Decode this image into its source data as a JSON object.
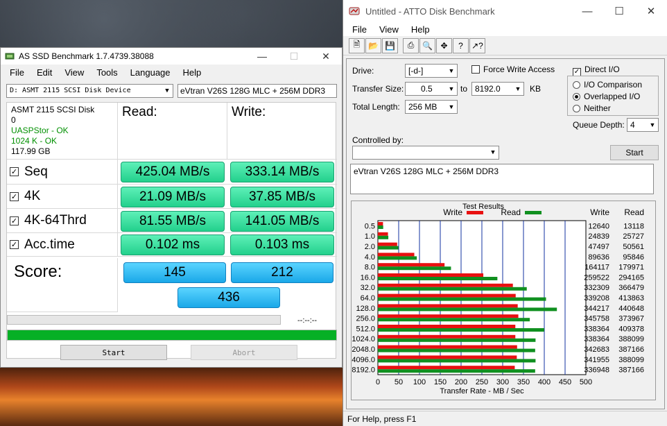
{
  "asssd": {
    "title": "AS SSD Benchmark 1.7.4739.38088",
    "menu": [
      "File",
      "Edit",
      "View",
      "Tools",
      "Language",
      "Help"
    ],
    "device_select": "D: ASMT 2115 SCSI Disk Device",
    "device_name": "eVtran V26S 128G MLC + 256M DDR3",
    "info": {
      "model": "ASMT 2115 SCSI Disk",
      "num": "0",
      "driver": "UASPStor - OK",
      "align": "1024 K - OK",
      "size": "117.99 GB"
    },
    "read_header": "Read:",
    "write_header": "Write:",
    "rows": [
      {
        "label": "Seq",
        "read": "425.04 MB/s",
        "write": "333.14 MB/s"
      },
      {
        "label": "4K",
        "read": "21.09 MB/s",
        "write": "37.85 MB/s"
      },
      {
        "label": "4K-64Thrd",
        "read": "81.55 MB/s",
        "write": "141.05 MB/s"
      },
      {
        "label": "Acc.time",
        "read": "0.102 ms",
        "write": "0.103 ms"
      }
    ],
    "score_label": "Score:",
    "score_read": "145",
    "score_write": "212",
    "score_total": "436",
    "timer": "--:--:--",
    "progress_fraction": 1.0,
    "start_label": "Start",
    "abort_label": "Abort"
  },
  "atto": {
    "title": "Untitled - ATTO Disk Benchmark",
    "menu": [
      "File",
      "View",
      "Help"
    ],
    "drive_label": "Drive:",
    "drive_value": "[-d-]",
    "force_write": "Force Write Access",
    "direct_io": "Direct I/O",
    "transfer_size_label": "Transfer Size:",
    "ts_from": "0.5",
    "ts_to_label": "to",
    "ts_to": "8192.0",
    "ts_unit": "KB",
    "io_comparison": "I/O Comparison",
    "overlapped_io": "Overlapped I/O",
    "neither": "Neither",
    "total_length_label": "Total Length:",
    "total_length": "256 MB",
    "queue_depth_label": "Queue Depth:",
    "queue_depth": "4",
    "controlled_by": "Controlled by:",
    "start_label": "Start",
    "description": "eVtran V26S 128G MLC + 256M DDR3",
    "status": "For Help, press F1",
    "colors": {
      "write": "#e81010",
      "read": "#109020"
    }
  },
  "chart_data": {
    "type": "bar",
    "title": "Test Results",
    "xlabel": "Transfer Rate - MB / Sec",
    "ylabel": "",
    "legend": [
      "Write",
      "Read"
    ],
    "col_headers": [
      "Write",
      "Read"
    ],
    "categories": [
      "0.5",
      "1.0",
      "2.0",
      "4.0",
      "8.0",
      "16.0",
      "32.0",
      "64.0",
      "128.0",
      "256.0",
      "512.0",
      "1024.0",
      "2048.0",
      "4096.0",
      "8192.0"
    ],
    "xlim": [
      0,
      500
    ],
    "xticks": [
      "0",
      "50",
      "100",
      "150",
      "200",
      "250",
      "300",
      "350",
      "400",
      "450",
      "500"
    ],
    "series": [
      {
        "name": "Write",
        "values": [
          12640,
          24839,
          47497,
          89636,
          164117,
          259522,
          332309,
          339208,
          344217,
          345758,
          338364,
          338364,
          342683,
          341955,
          336948
        ]
      },
      {
        "name": "Read",
        "values": [
          13118,
          25727,
          50561,
          95846,
          179971,
          294165,
          366479,
          413863,
          440648,
          373967,
          409378,
          388099,
          387166,
          388099,
          387166
        ]
      }
    ]
  }
}
